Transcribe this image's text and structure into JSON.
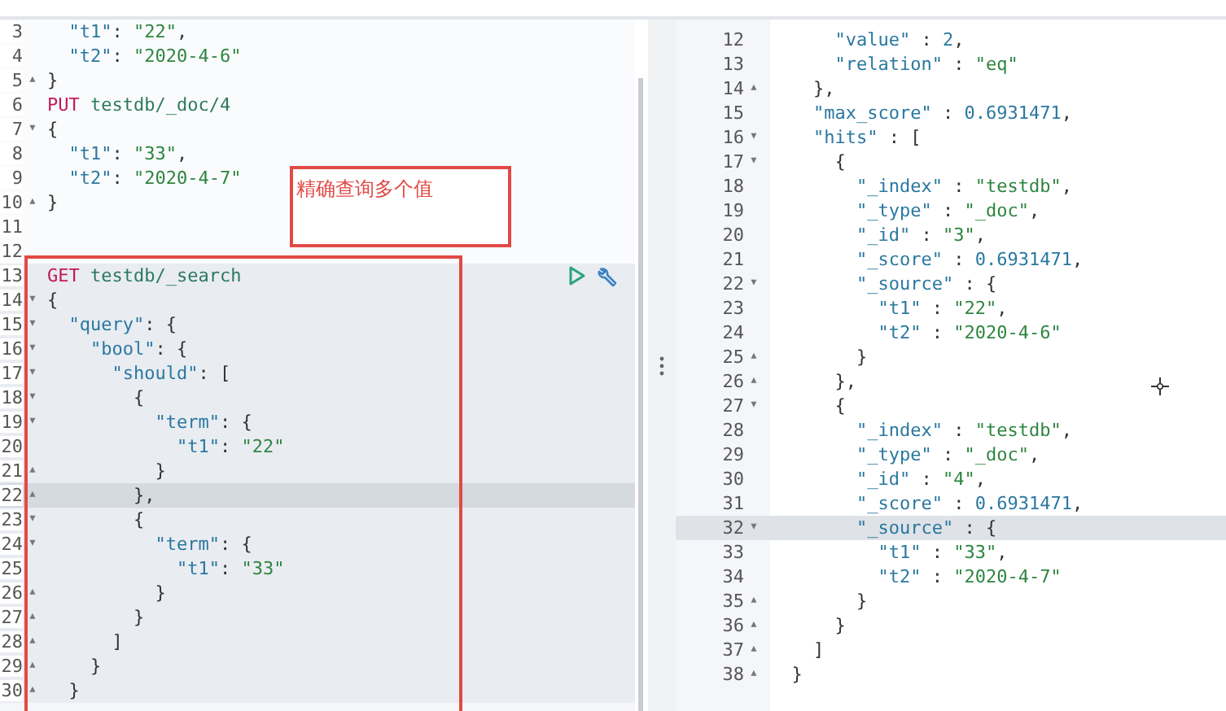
{
  "request_pane": {
    "lines": [
      {
        "number": "3",
        "text": "  \"t1\": \"22\",",
        "current": false,
        "in_request": false
      },
      {
        "number": "4",
        "text": "  \"t2\": \"2020-4-6\"",
        "current": false,
        "in_request": false
      },
      {
        "number": "5",
        "text": "}",
        "fold": "▴",
        "current": false,
        "in_request": false
      },
      {
        "number": "6",
        "text": "PUT testdb/_doc/4",
        "current": false,
        "in_request": false
      },
      {
        "number": "7",
        "text": "{",
        "fold": "▾",
        "current": false,
        "in_request": false
      },
      {
        "number": "8",
        "text": "  \"t1\": \"33\",",
        "current": false,
        "in_request": false
      },
      {
        "number": "9",
        "text": "  \"t2\": \"2020-4-7\"",
        "current": false,
        "in_request": false
      },
      {
        "number": "10",
        "text": "}",
        "fold": "▴",
        "current": false,
        "in_request": false
      },
      {
        "number": "11",
        "current": false,
        "in_request": false
      },
      {
        "number": "12",
        "current": false,
        "in_request": false
      },
      {
        "number": "13",
        "text": "GET testdb/_search",
        "current": false,
        "in_request": true
      },
      {
        "number": "14",
        "text": "{",
        "fold": "▾",
        "current": false,
        "in_request": true
      },
      {
        "number": "15",
        "text": "  \"query\": {",
        "fold": "▾",
        "current": false,
        "in_request": true
      },
      {
        "number": "16",
        "text": "    \"bool\": {",
        "fold": "▾",
        "current": false,
        "in_request": true
      },
      {
        "number": "17",
        "text": "      \"should\": [",
        "fold": "▾",
        "current": false,
        "in_request": true
      },
      {
        "number": "18",
        "text": "        {",
        "fold": "▾",
        "current": false,
        "in_request": true
      },
      {
        "number": "19",
        "text": "          \"term\": {",
        "fold": "▾",
        "current": false,
        "in_request": true
      },
      {
        "number": "20",
        "text": "            \"t1\": \"22\"",
        "current": false,
        "in_request": true
      },
      {
        "number": "21",
        "text": "          }",
        "fold": "▴",
        "current": false,
        "in_request": true
      },
      {
        "number": "22",
        "text": "        },",
        "fold": "▴",
        "current": true,
        "in_request": true
      },
      {
        "number": "23",
        "text": "        {",
        "fold": "▾",
        "current": false,
        "in_request": true
      },
      {
        "number": "24",
        "text": "          \"term\": {",
        "fold": "▾",
        "current": false,
        "in_request": true
      },
      {
        "number": "25",
        "text": "            \"t1\": \"33\"",
        "current": false,
        "in_request": true
      },
      {
        "number": "26",
        "text": "          }",
        "fold": "▴",
        "current": false,
        "in_request": true
      },
      {
        "number": "27",
        "text": "        }",
        "fold": "▴",
        "current": false,
        "in_request": true
      },
      {
        "number": "28",
        "text": "      ]",
        "fold": "▴",
        "current": false,
        "in_request": true
      },
      {
        "number": "29",
        "text": "    }",
        "fold": "▴",
        "current": false,
        "in_request": true
      },
      {
        "number": "30",
        "text": "  }",
        "fold": "▴",
        "current": false,
        "in_request": true
      }
    ]
  },
  "annotation": {
    "note": "精确查询多个值"
  },
  "response_pane": {
    "lines": [
      {
        "number": "12",
        "text": "      \"value\" : 2,",
        "current": false
      },
      {
        "number": "13",
        "text": "      \"relation\" : \"eq\"",
        "current": false
      },
      {
        "number": "14",
        "text": "    },",
        "fold": "▴",
        "current": false
      },
      {
        "number": "15",
        "text": "    \"max_score\" : 0.6931471,",
        "current": false
      },
      {
        "number": "16",
        "text": "    \"hits\" : [",
        "fold": "▾",
        "current": false
      },
      {
        "number": "17",
        "text": "      {",
        "fold": "▾",
        "current": false
      },
      {
        "number": "18",
        "text": "        \"_index\" : \"testdb\",",
        "current": false
      },
      {
        "number": "19",
        "text": "        \"_type\" : \"_doc\",",
        "current": false
      },
      {
        "number": "20",
        "text": "        \"_id\" : \"3\",",
        "current": false
      },
      {
        "number": "21",
        "text": "        \"_score\" : 0.6931471,",
        "current": false
      },
      {
        "number": "22",
        "text": "        \"_source\" : {",
        "fold": "▾",
        "current": false
      },
      {
        "number": "23",
        "text": "          \"t1\" : \"22\",",
        "current": false
      },
      {
        "number": "24",
        "text": "          \"t2\" : \"2020-4-6\"",
        "current": false
      },
      {
        "number": "25",
        "text": "        }",
        "fold": "▴",
        "current": false
      },
      {
        "number": "26",
        "text": "      },",
        "fold": "▴",
        "current": false
      },
      {
        "number": "27",
        "text": "      {",
        "fold": "▾",
        "current": false
      },
      {
        "number": "28",
        "text": "        \"_index\" : \"testdb\",",
        "current": false
      },
      {
        "number": "29",
        "text": "        \"_type\" : \"_doc\",",
        "current": false
      },
      {
        "number": "30",
        "text": "        \"_id\" : \"4\",",
        "current": false
      },
      {
        "number": "31",
        "text": "        \"_score\" : 0.6931471,",
        "current": false
      },
      {
        "number": "32",
        "text": "        \"_source\" : {",
        "fold": "▾",
        "current": true
      },
      {
        "number": "33",
        "text": "          \"t1\" : \"33\",",
        "current": false
      },
      {
        "number": "34",
        "text": "          \"t2\" : \"2020-4-7\"",
        "current": false
      },
      {
        "number": "35",
        "text": "        }",
        "fold": "▴",
        "current": false
      },
      {
        "number": "36",
        "text": "      }",
        "fold": "▴",
        "current": false
      },
      {
        "number": "37",
        "text": "    ]",
        "fold": "▴",
        "current": false
      },
      {
        "number": "38",
        "text": "  }",
        "fold": "▴",
        "current": false
      }
    ]
  }
}
